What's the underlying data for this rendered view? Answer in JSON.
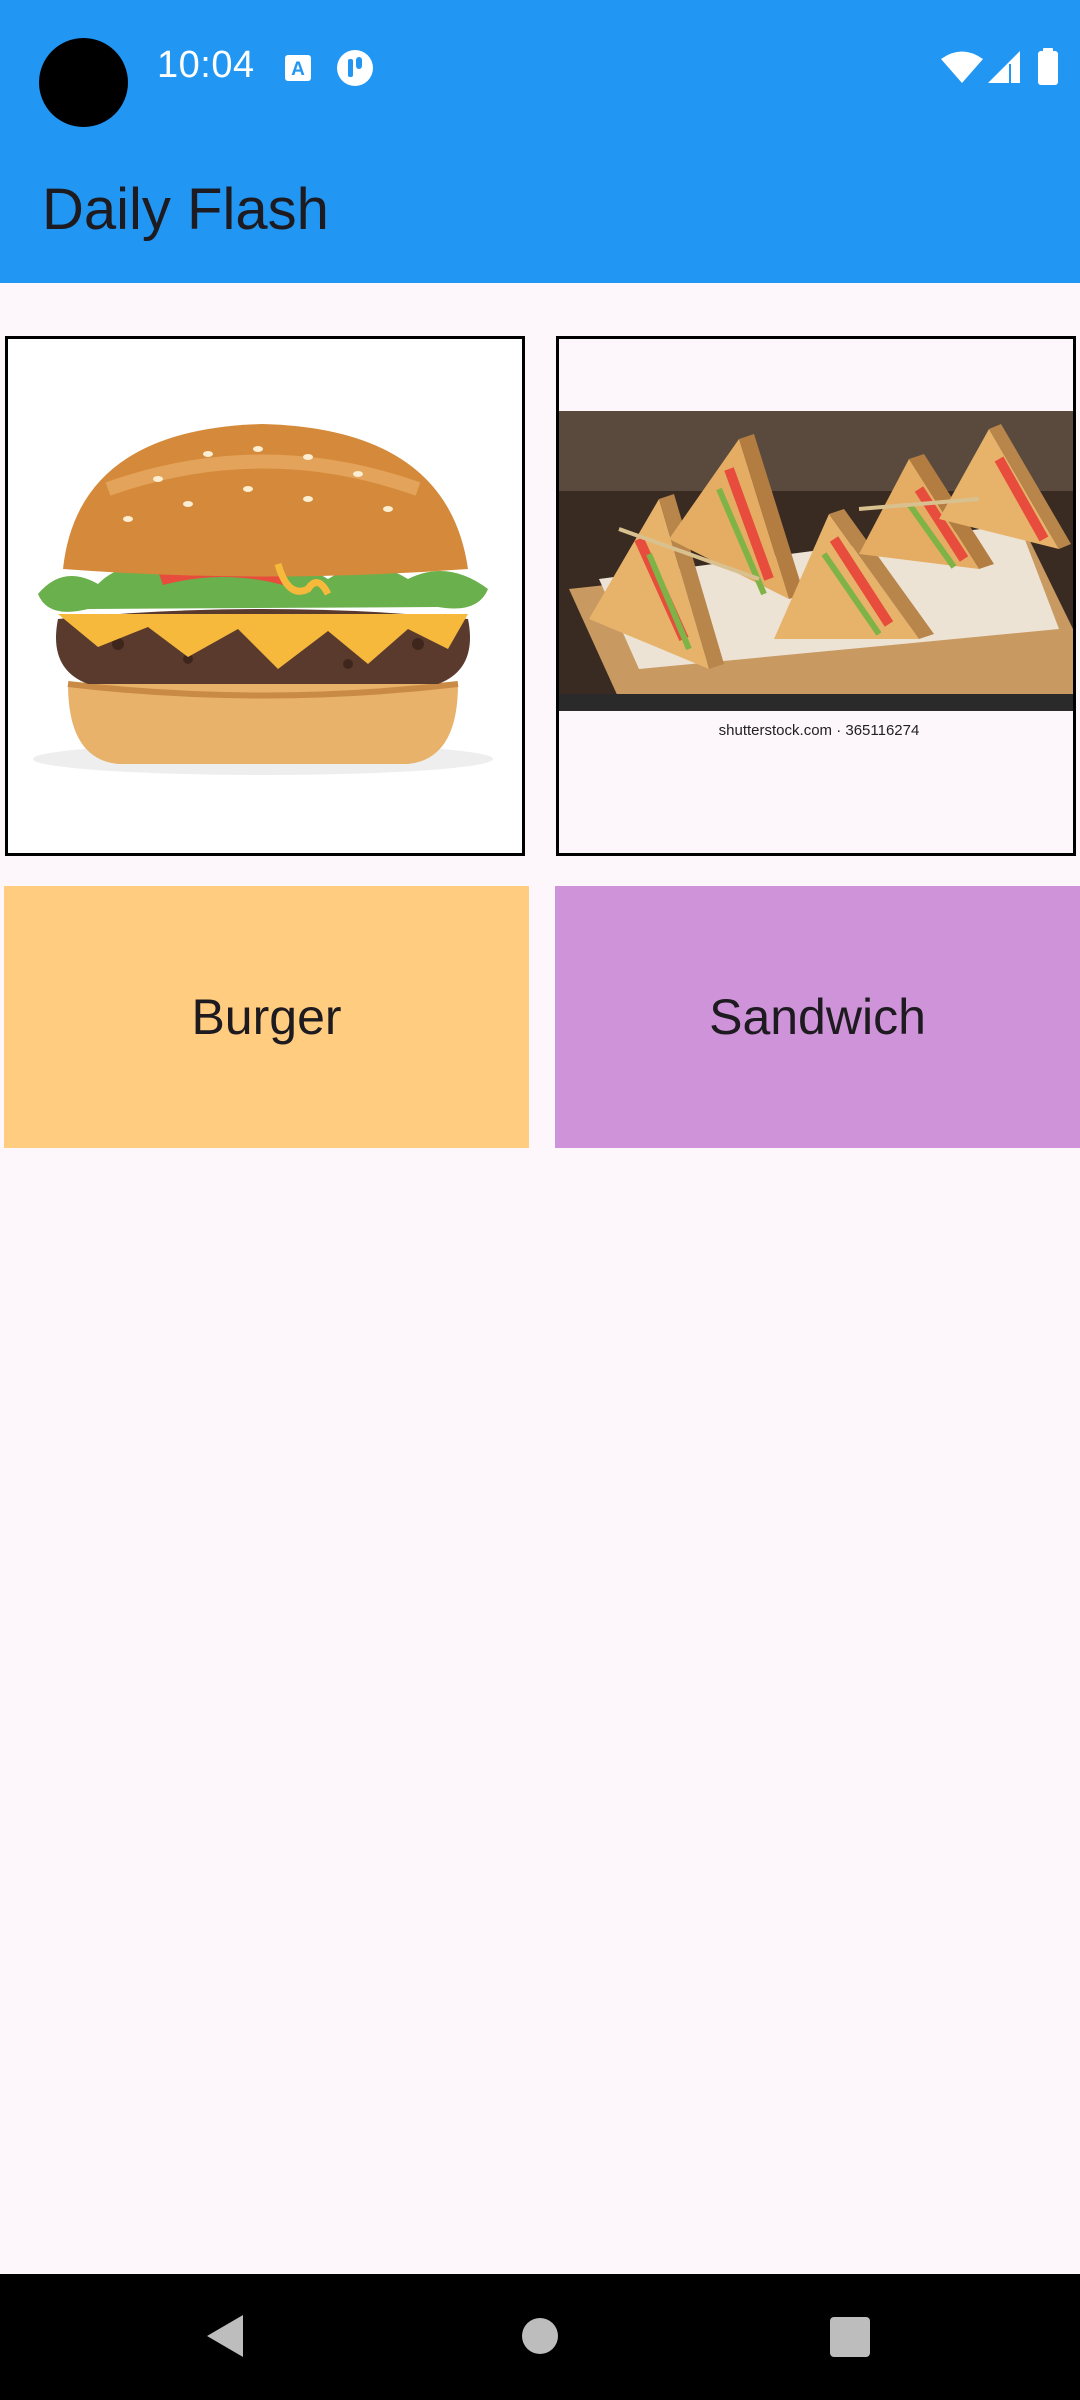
{
  "status_bar": {
    "time": "10:04",
    "icons": [
      "font-accessibility-icon",
      "app-notification-icon",
      "wifi-icon",
      "cellular-signal-icon",
      "battery-icon"
    ]
  },
  "app_bar": {
    "title": "Daily Flash",
    "color": "#2196f3"
  },
  "items": [
    {
      "label": "Burger",
      "image": "burger-photo",
      "tile_color": "#ffcc80"
    },
    {
      "label": "Sandwich",
      "image": "sandwich-photo",
      "tile_color": "#ce93d8",
      "image_caption": "shutterstock.com · 365116274"
    }
  ],
  "nav_bar": {
    "buttons": [
      "back-icon",
      "home-icon",
      "recents-icon"
    ]
  }
}
